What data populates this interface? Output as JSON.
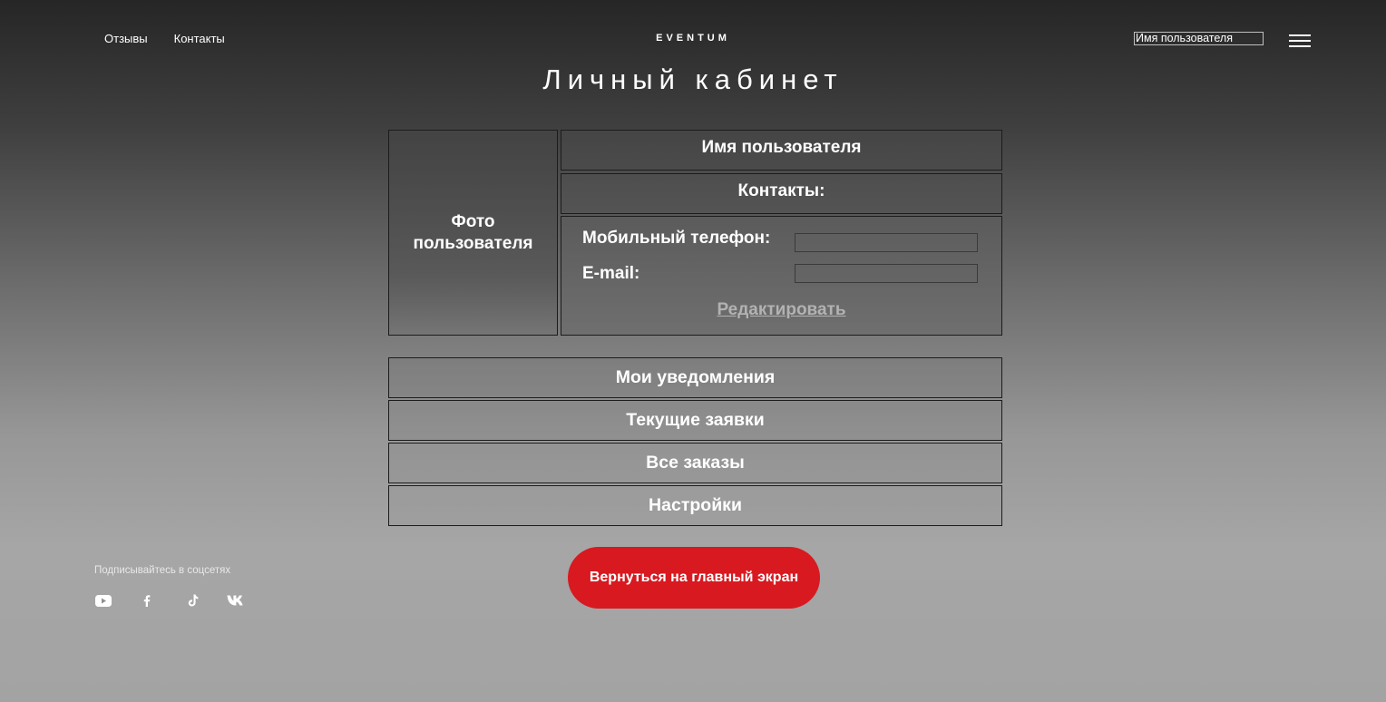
{
  "header": {
    "nav": [
      {
        "label": "Отзывы"
      },
      {
        "label": "Контакты"
      }
    ],
    "logo": "EVENTUM",
    "user_box": "Имя пользователя",
    "menu_icon": "hamburger-menu-icon"
  },
  "page_title": "Личный кабинет",
  "profile": {
    "photo_label": "Фото пользователя",
    "username": "Имя пользователя",
    "contacts_heading": "Контакты:",
    "fields": [
      {
        "label": "Мобильный телефон:",
        "value": ""
      },
      {
        "label": "E-mail:",
        "value": ""
      }
    ],
    "edit_label": "Редактировать"
  },
  "menu": [
    {
      "label": "Мои уведомления"
    },
    {
      "label": "Текущие заявки"
    },
    {
      "label": "Все заказы"
    },
    {
      "label": "Настройки"
    }
  ],
  "back_button": "Вернуться на главный экран",
  "social": {
    "label": "Подписывайтесь в соцсетях",
    "icons": [
      "youtube-icon",
      "facebook-icon",
      "tiktok-icon",
      "vk-icon"
    ]
  },
  "colors": {
    "accent": "#d81920",
    "text": "#ffffff",
    "edit_link": "#b2b2b2"
  }
}
